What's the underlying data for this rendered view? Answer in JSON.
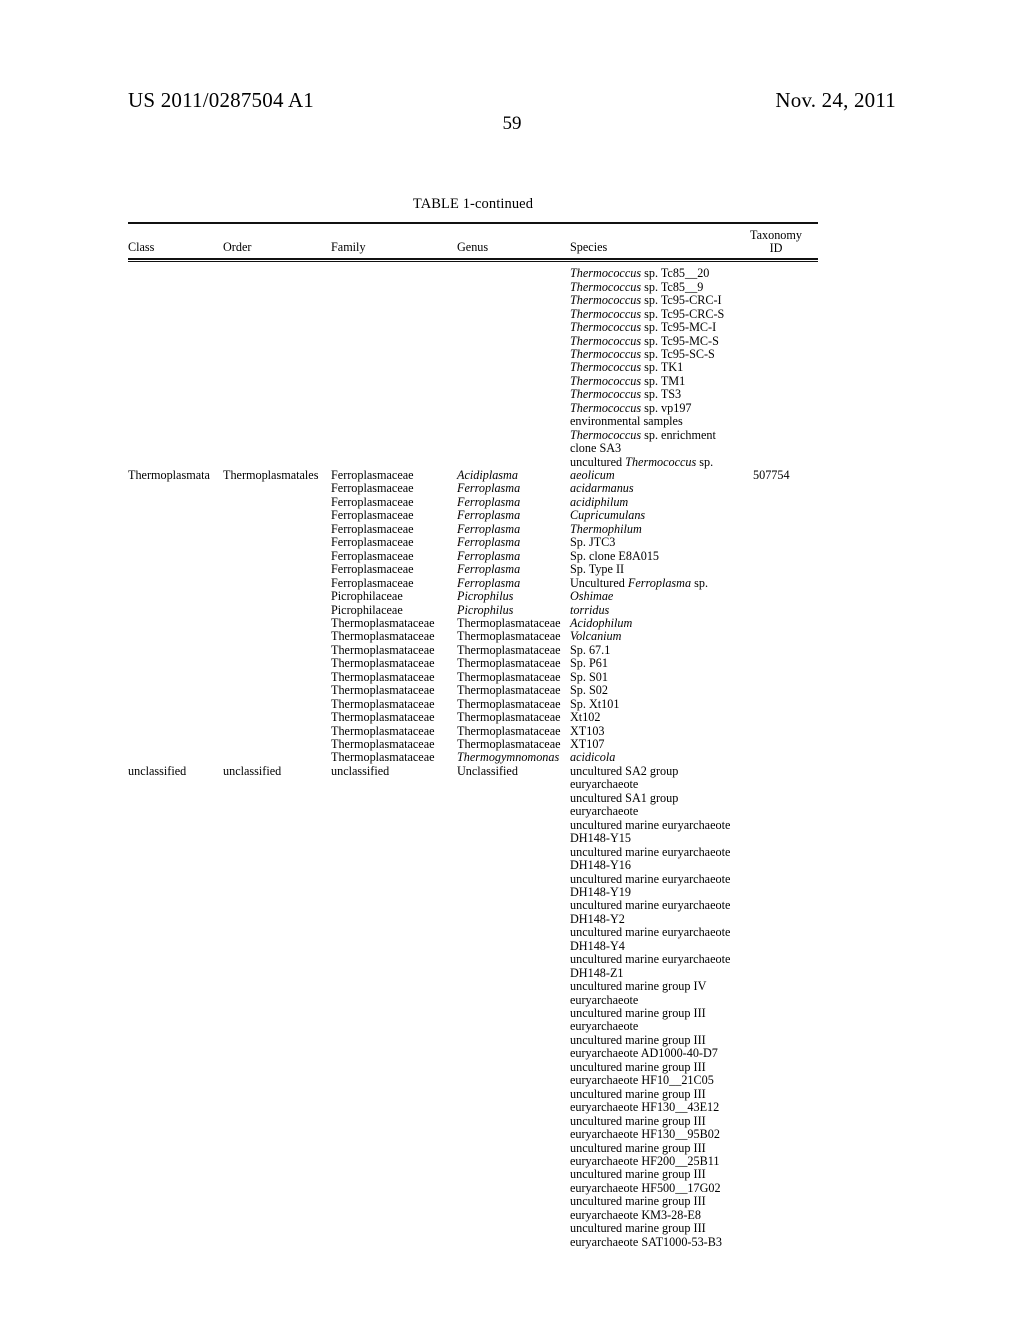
{
  "header": {
    "publication_number": "US 2011/0287504 A1",
    "publication_date": "Nov. 24, 2011",
    "page_number": "59"
  },
  "table": {
    "caption": "TABLE 1-continued",
    "columns": [
      {
        "key": "class",
        "label": "Class"
      },
      {
        "key": "order",
        "label": "Order"
      },
      {
        "key": "family",
        "label": "Family"
      },
      {
        "key": "genus",
        "label": "Genus"
      },
      {
        "key": "species",
        "label": "Species"
      },
      {
        "key": "taxonomy_id",
        "label_line1": "Taxonomy",
        "label_line2": "ID"
      }
    ],
    "rows": [
      {
        "class": "",
        "order": "",
        "family": "",
        "genus": "",
        "species_italic": "Thermococcus",
        "species_roman": " sp. Tc85__20",
        "taxonomy_id": ""
      },
      {
        "class": "",
        "order": "",
        "family": "",
        "genus": "",
        "species_italic": "Thermococcus",
        "species_roman": " sp. Tc85__9",
        "taxonomy_id": ""
      },
      {
        "class": "",
        "order": "",
        "family": "",
        "genus": "",
        "species_italic": "Thermococcus",
        "species_roman": " sp. Tc95-CRC-I",
        "taxonomy_id": ""
      },
      {
        "class": "",
        "order": "",
        "family": "",
        "genus": "",
        "species_italic": "Thermococcus",
        "species_roman": " sp. Tc95-CRC-S",
        "taxonomy_id": ""
      },
      {
        "class": "",
        "order": "",
        "family": "",
        "genus": "",
        "species_italic": "Thermococcus",
        "species_roman": " sp. Tc95-MC-I",
        "taxonomy_id": ""
      },
      {
        "class": "",
        "order": "",
        "family": "",
        "genus": "",
        "species_italic": "Thermococcus",
        "species_roman": " sp. Tc95-MC-S",
        "taxonomy_id": ""
      },
      {
        "class": "",
        "order": "",
        "family": "",
        "genus": "",
        "species_italic": "Thermococcus",
        "species_roman": " sp. Tc95-SC-S",
        "taxonomy_id": ""
      },
      {
        "class": "",
        "order": "",
        "family": "",
        "genus": "",
        "species_italic": "Thermococcus",
        "species_roman": " sp. TK1",
        "taxonomy_id": ""
      },
      {
        "class": "",
        "order": "",
        "family": "",
        "genus": "",
        "species_italic": "Thermococcus",
        "species_roman": " sp. TM1",
        "taxonomy_id": ""
      },
      {
        "class": "",
        "order": "",
        "family": "",
        "genus": "",
        "species_italic": "Thermococcus",
        "species_roman": " sp. TS3",
        "taxonomy_id": ""
      },
      {
        "class": "",
        "order": "",
        "family": "",
        "genus": "",
        "species_italic": "Thermococcus",
        "species_roman": " sp. vp197",
        "taxonomy_id": ""
      },
      {
        "class": "",
        "order": "",
        "family": "",
        "genus": "",
        "species_italic": "",
        "species_roman": "environmental samples",
        "taxonomy_id": ""
      },
      {
        "class": "",
        "order": "",
        "family": "",
        "genus": "",
        "species_italic": "Thermococcus",
        "species_roman": " sp. enrichment",
        "taxonomy_id": ""
      },
      {
        "class": "",
        "order": "",
        "family": "",
        "genus": "",
        "species_italic": "",
        "species_roman": "clone SA3",
        "taxonomy_id": ""
      },
      {
        "class": "",
        "order": "",
        "family": "",
        "genus": "",
        "species_prefix": "uncultured ",
        "species_italic": "Thermococcus",
        "species_roman": " sp.",
        "taxonomy_id": ""
      },
      {
        "class": "Thermoplasmata",
        "order": "Thermoplasmatales",
        "family": "Ferroplasmaceae",
        "genus": "Acidiplasma",
        "genus_italic": true,
        "species_roman": "",
        "species_all_italic": "aeolicum",
        "taxonomy_id": "507754"
      },
      {
        "class": "",
        "order": "",
        "family": "Ferroplasmaceae",
        "genus": "Ferroplasma",
        "genus_italic": true,
        "species_all_italic": "acidarmanus",
        "taxonomy_id": ""
      },
      {
        "class": "",
        "order": "",
        "family": "Ferroplasmaceae",
        "genus": "Ferroplasma",
        "genus_italic": true,
        "species_all_italic": "acidiphilum",
        "taxonomy_id": ""
      },
      {
        "class": "",
        "order": "",
        "family": "Ferroplasmaceae",
        "genus": "Ferroplasma",
        "genus_italic": true,
        "species_all_italic": "Cupricumulans",
        "taxonomy_id": ""
      },
      {
        "class": "",
        "order": "",
        "family": "Ferroplasmaceae",
        "genus": "Ferroplasma",
        "genus_italic": true,
        "species_all_italic": "Thermophilum",
        "taxonomy_id": ""
      },
      {
        "class": "",
        "order": "",
        "family": "Ferroplasmaceae",
        "genus": "Ferroplasma",
        "genus_italic": true,
        "species_roman": "Sp. JTC3",
        "taxonomy_id": ""
      },
      {
        "class": "",
        "order": "",
        "family": "Ferroplasmaceae",
        "genus": "Ferroplasma",
        "genus_italic": true,
        "species_roman": "Sp. clone E8A015",
        "taxonomy_id": ""
      },
      {
        "class": "",
        "order": "",
        "family": "Ferroplasmaceae",
        "genus": "Ferroplasma",
        "genus_italic": true,
        "species_roman": "Sp. Type II",
        "taxonomy_id": ""
      },
      {
        "class": "",
        "order": "",
        "family": "Ferroplasmaceae",
        "genus": "Ferroplasma",
        "genus_italic": true,
        "species_prefix": "Uncultured ",
        "species_italic": "Ferroplasma",
        "species_roman": " sp.",
        "taxonomy_id": ""
      },
      {
        "class": "",
        "order": "",
        "family": "Picrophilaceae",
        "genus": "Picrophilus",
        "genus_italic": true,
        "species_all_italic": "Oshimae",
        "taxonomy_id": ""
      },
      {
        "class": "",
        "order": "",
        "family": "Picrophilaceae",
        "genus": "Picrophilus",
        "genus_italic": true,
        "species_all_italic": "torridus",
        "taxonomy_id": ""
      },
      {
        "class": "",
        "order": "",
        "family": "Thermoplasmataceae",
        "genus": "Thermoplasmataceae",
        "genus_italic": false,
        "species_all_italic": "Acidophilum",
        "taxonomy_id": ""
      },
      {
        "class": "",
        "order": "",
        "family": "Thermoplasmataceae",
        "genus": "Thermoplasmataceae",
        "genus_italic": false,
        "species_all_italic": "Volcanium",
        "taxonomy_id": ""
      },
      {
        "class": "",
        "order": "",
        "family": "Thermoplasmataceae",
        "genus": "Thermoplasmataceae",
        "genus_italic": false,
        "species_roman": "Sp. 67.1",
        "taxonomy_id": ""
      },
      {
        "class": "",
        "order": "",
        "family": "Thermoplasmataceae",
        "genus": "Thermoplasmataceae",
        "genus_italic": false,
        "species_roman": "Sp. P61",
        "taxonomy_id": ""
      },
      {
        "class": "",
        "order": "",
        "family": "Thermoplasmataceae",
        "genus": "Thermoplasmataceae",
        "genus_italic": false,
        "species_roman": "Sp. S01",
        "taxonomy_id": ""
      },
      {
        "class": "",
        "order": "",
        "family": "Thermoplasmataceae",
        "genus": "Thermoplasmataceae",
        "genus_italic": false,
        "species_roman": "Sp. S02",
        "taxonomy_id": ""
      },
      {
        "class": "",
        "order": "",
        "family": "Thermoplasmataceae",
        "genus": "Thermoplasmataceae",
        "genus_italic": false,
        "species_roman": "Sp. Xt101",
        "taxonomy_id": ""
      },
      {
        "class": "",
        "order": "",
        "family": "Thermoplasmataceae",
        "genus": "Thermoplasmataceae",
        "genus_italic": false,
        "species_roman": "Xt102",
        "taxonomy_id": ""
      },
      {
        "class": "",
        "order": "",
        "family": "Thermoplasmataceae",
        "genus": "Thermoplasmataceae",
        "genus_italic": false,
        "species_roman": "XT103",
        "taxonomy_id": ""
      },
      {
        "class": "",
        "order": "",
        "family": "Thermoplasmataceae",
        "genus": "Thermoplasmataceae",
        "genus_italic": false,
        "species_roman": "XT107",
        "taxonomy_id": ""
      },
      {
        "class": "",
        "order": "",
        "family": "Thermoplasmataceae",
        "genus": "Thermogymnomonas",
        "genus_italic": true,
        "species_all_italic": "acidicola",
        "taxonomy_id": ""
      },
      {
        "class": "unclassified",
        "order": "unclassified",
        "family": "unclassified",
        "genus": "Unclassified",
        "genus_italic": false,
        "species_roman": "uncultured SA2 group",
        "taxonomy_id": ""
      },
      {
        "class": "",
        "order": "",
        "family": "",
        "genus": "",
        "species_roman": "euryarchaeote",
        "taxonomy_id": ""
      },
      {
        "class": "",
        "order": "",
        "family": "",
        "genus": "",
        "species_roman": "uncultured SA1 group",
        "taxonomy_id": ""
      },
      {
        "class": "",
        "order": "",
        "family": "",
        "genus": "",
        "species_roman": "euryarchaeote",
        "taxonomy_id": ""
      },
      {
        "class": "",
        "order": "",
        "family": "",
        "genus": "",
        "species_roman": "uncultured marine euryarchaeote",
        "taxonomy_id": ""
      },
      {
        "class": "",
        "order": "",
        "family": "",
        "genus": "",
        "species_roman": "DH148-Y15",
        "taxonomy_id": ""
      },
      {
        "class": "",
        "order": "",
        "family": "",
        "genus": "",
        "species_roman": "uncultured marine euryarchaeote",
        "taxonomy_id": ""
      },
      {
        "class": "",
        "order": "",
        "family": "",
        "genus": "",
        "species_roman": "DH148-Y16",
        "taxonomy_id": ""
      },
      {
        "class": "",
        "order": "",
        "family": "",
        "genus": "",
        "species_roman": "uncultured marine euryarchaeote",
        "taxonomy_id": ""
      },
      {
        "class": "",
        "order": "",
        "family": "",
        "genus": "",
        "species_roman": "DH148-Y19",
        "taxonomy_id": ""
      },
      {
        "class": "",
        "order": "",
        "family": "",
        "genus": "",
        "species_roman": "uncultured marine euryarchaeote",
        "taxonomy_id": ""
      },
      {
        "class": "",
        "order": "",
        "family": "",
        "genus": "",
        "species_roman": "DH148-Y2",
        "taxonomy_id": ""
      },
      {
        "class": "",
        "order": "",
        "family": "",
        "genus": "",
        "species_roman": "uncultured marine euryarchaeote",
        "taxonomy_id": ""
      },
      {
        "class": "",
        "order": "",
        "family": "",
        "genus": "",
        "species_roman": "DH148-Y4",
        "taxonomy_id": ""
      },
      {
        "class": "",
        "order": "",
        "family": "",
        "genus": "",
        "species_roman": "uncultured marine euryarchaeote",
        "taxonomy_id": ""
      },
      {
        "class": "",
        "order": "",
        "family": "",
        "genus": "",
        "species_roman": "DH148-Z1",
        "taxonomy_id": ""
      },
      {
        "class": "",
        "order": "",
        "family": "",
        "genus": "",
        "species_roman": "uncultured marine group IV",
        "taxonomy_id": ""
      },
      {
        "class": "",
        "order": "",
        "family": "",
        "genus": "",
        "species_roman": "euryarchaeote",
        "taxonomy_id": ""
      },
      {
        "class": "",
        "order": "",
        "family": "",
        "genus": "",
        "species_roman": "uncultured marine group III",
        "taxonomy_id": ""
      },
      {
        "class": "",
        "order": "",
        "family": "",
        "genus": "",
        "species_roman": "euryarchaeote",
        "taxonomy_id": ""
      },
      {
        "class": "",
        "order": "",
        "family": "",
        "genus": "",
        "species_roman": "uncultured marine group III",
        "taxonomy_id": ""
      },
      {
        "class": "",
        "order": "",
        "family": "",
        "genus": "",
        "species_roman": "euryarchaeote AD1000-40-D7",
        "taxonomy_id": ""
      },
      {
        "class": "",
        "order": "",
        "family": "",
        "genus": "",
        "species_roman": "uncultured marine group III",
        "taxonomy_id": ""
      },
      {
        "class": "",
        "order": "",
        "family": "",
        "genus": "",
        "species_roman": "euryarchaeote HF10__21C05",
        "taxonomy_id": ""
      },
      {
        "class": "",
        "order": "",
        "family": "",
        "genus": "",
        "species_roman": "uncultured marine group III",
        "taxonomy_id": ""
      },
      {
        "class": "",
        "order": "",
        "family": "",
        "genus": "",
        "species_roman": "euryarchaeote HF130__43E12",
        "taxonomy_id": ""
      },
      {
        "class": "",
        "order": "",
        "family": "",
        "genus": "",
        "species_roman": "uncultured marine group III",
        "taxonomy_id": ""
      },
      {
        "class": "",
        "order": "",
        "family": "",
        "genus": "",
        "species_roman": "euryarchaeote HF130__95B02",
        "taxonomy_id": ""
      },
      {
        "class": "",
        "order": "",
        "family": "",
        "genus": "",
        "species_roman": "uncultured marine group III",
        "taxonomy_id": ""
      },
      {
        "class": "",
        "order": "",
        "family": "",
        "genus": "",
        "species_roman": "euryarchaeote HF200__25B11",
        "taxonomy_id": ""
      },
      {
        "class": "",
        "order": "",
        "family": "",
        "genus": "",
        "species_roman": "uncultured marine group III",
        "taxonomy_id": ""
      },
      {
        "class": "",
        "order": "",
        "family": "",
        "genus": "",
        "species_roman": "euryarchaeote HF500__17G02",
        "taxonomy_id": ""
      },
      {
        "class": "",
        "order": "",
        "family": "",
        "genus": "",
        "species_roman": "uncultured marine group III",
        "taxonomy_id": ""
      },
      {
        "class": "",
        "order": "",
        "family": "",
        "genus": "",
        "species_roman": "euryarchaeote KM3-28-E8",
        "taxonomy_id": ""
      },
      {
        "class": "",
        "order": "",
        "family": "",
        "genus": "",
        "species_roman": "uncultured marine group III",
        "taxonomy_id": ""
      },
      {
        "class": "",
        "order": "",
        "family": "",
        "genus": "",
        "species_roman": "euryarchaeote SAT1000-53-B3",
        "taxonomy_id": ""
      }
    ]
  }
}
